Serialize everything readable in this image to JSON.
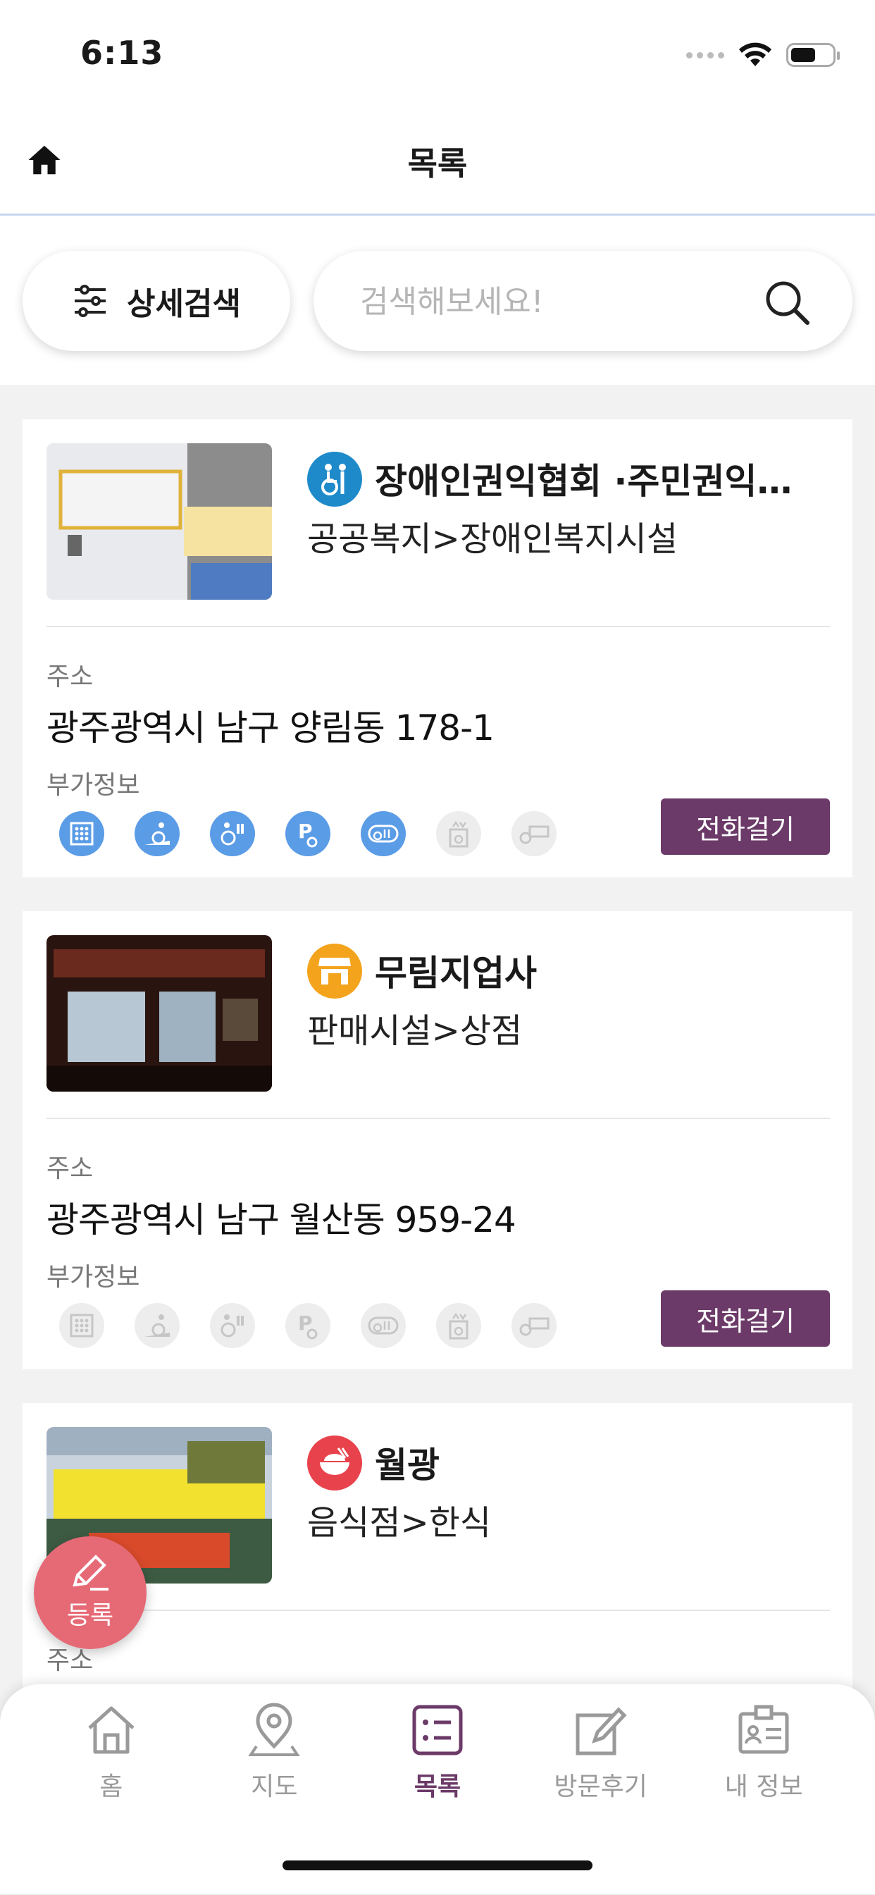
{
  "status": {
    "time": "6:13"
  },
  "header": {
    "title": "목록"
  },
  "search": {
    "filter_label": "상세검색",
    "placeholder": "검색해보세요!"
  },
  "places": [
    {
      "title": "장애인권익협회 ·주민권익…",
      "category": "공공복지>장애인복지시설",
      "category_icon": "wheelchair-person-icon",
      "category_color": "#1e8ac9",
      "address_label": "주소",
      "address": "광주광역시 남구 양림동 178-1",
      "extra_label": "부가정보",
      "features_enabled": [
        true,
        true,
        true,
        true,
        true,
        false,
        false
      ],
      "call_label": "전화걸기"
    },
    {
      "title": "무림지업사",
      "category": "판매시설>상점",
      "category_icon": "store-icon",
      "category_color": "#f4a41c",
      "address_label": "주소",
      "address": "광주광역시 남구 월산동 959-24",
      "extra_label": "부가정보",
      "features_enabled": [
        false,
        false,
        false,
        false,
        false,
        false,
        false
      ],
      "call_label": "전화걸기"
    },
    {
      "title": "월광",
      "category": "음식점>한식",
      "category_icon": "rice-bowl-icon",
      "category_color": "#e8424c",
      "address_label": "주소"
    }
  ],
  "fab": {
    "label": "등록"
  },
  "tabs": [
    {
      "label": "홈",
      "icon": "house-icon"
    },
    {
      "label": "지도",
      "icon": "map-pin-icon"
    },
    {
      "label": "목록",
      "icon": "list-icon",
      "active": true
    },
    {
      "label": "방문후기",
      "icon": "review-pen-icon"
    },
    {
      "label": "내 정보",
      "icon": "id-card-icon"
    }
  ],
  "colors": {
    "accent": "#6b3a68",
    "feature_on": "#5b9ce6",
    "fab": "#e66a76"
  }
}
